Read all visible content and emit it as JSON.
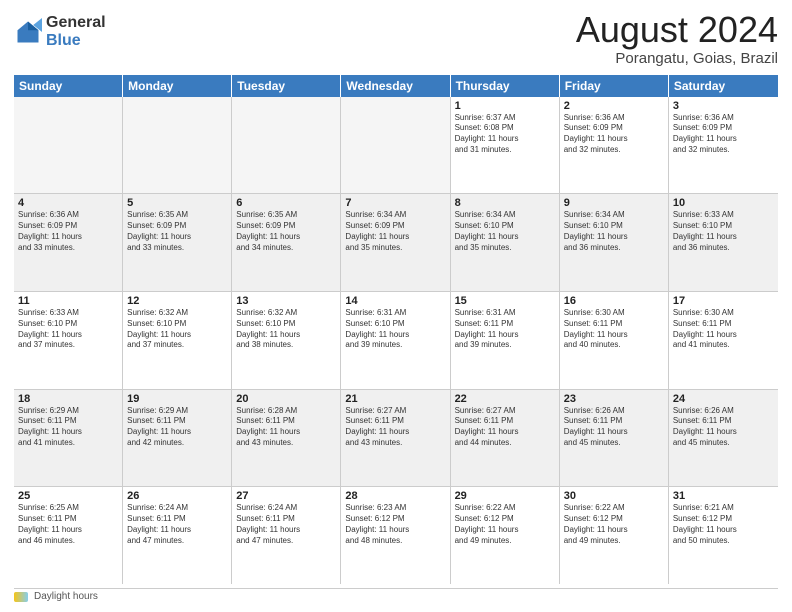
{
  "header": {
    "logo_general": "General",
    "logo_blue": "Blue",
    "month_title": "August 2024",
    "location": "Porangatu, Goias, Brazil"
  },
  "days_of_week": [
    "Sunday",
    "Monday",
    "Tuesday",
    "Wednesday",
    "Thursday",
    "Friday",
    "Saturday"
  ],
  "footer_label": "Daylight hours",
  "weeks": [
    [
      {
        "day": "",
        "info": "",
        "empty": true
      },
      {
        "day": "",
        "info": "",
        "empty": true
      },
      {
        "day": "",
        "info": "",
        "empty": true
      },
      {
        "day": "",
        "info": "",
        "empty": true
      },
      {
        "day": "1",
        "info": "Sunrise: 6:37 AM\nSunset: 6:08 PM\nDaylight: 11 hours\nand 31 minutes.",
        "empty": false
      },
      {
        "day": "2",
        "info": "Sunrise: 6:36 AM\nSunset: 6:09 PM\nDaylight: 11 hours\nand 32 minutes.",
        "empty": false
      },
      {
        "day": "3",
        "info": "Sunrise: 6:36 AM\nSunset: 6:09 PM\nDaylight: 11 hours\nand 32 minutes.",
        "empty": false
      }
    ],
    [
      {
        "day": "4",
        "info": "Sunrise: 6:36 AM\nSunset: 6:09 PM\nDaylight: 11 hours\nand 33 minutes.",
        "empty": false
      },
      {
        "day": "5",
        "info": "Sunrise: 6:35 AM\nSunset: 6:09 PM\nDaylight: 11 hours\nand 33 minutes.",
        "empty": false
      },
      {
        "day": "6",
        "info": "Sunrise: 6:35 AM\nSunset: 6:09 PM\nDaylight: 11 hours\nand 34 minutes.",
        "empty": false
      },
      {
        "day": "7",
        "info": "Sunrise: 6:34 AM\nSunset: 6:09 PM\nDaylight: 11 hours\nand 35 minutes.",
        "empty": false
      },
      {
        "day": "8",
        "info": "Sunrise: 6:34 AM\nSunset: 6:10 PM\nDaylight: 11 hours\nand 35 minutes.",
        "empty": false
      },
      {
        "day": "9",
        "info": "Sunrise: 6:34 AM\nSunset: 6:10 PM\nDaylight: 11 hours\nand 36 minutes.",
        "empty": false
      },
      {
        "day": "10",
        "info": "Sunrise: 6:33 AM\nSunset: 6:10 PM\nDaylight: 11 hours\nand 36 minutes.",
        "empty": false
      }
    ],
    [
      {
        "day": "11",
        "info": "Sunrise: 6:33 AM\nSunset: 6:10 PM\nDaylight: 11 hours\nand 37 minutes.",
        "empty": false
      },
      {
        "day": "12",
        "info": "Sunrise: 6:32 AM\nSunset: 6:10 PM\nDaylight: 11 hours\nand 37 minutes.",
        "empty": false
      },
      {
        "day": "13",
        "info": "Sunrise: 6:32 AM\nSunset: 6:10 PM\nDaylight: 11 hours\nand 38 minutes.",
        "empty": false
      },
      {
        "day": "14",
        "info": "Sunrise: 6:31 AM\nSunset: 6:10 PM\nDaylight: 11 hours\nand 39 minutes.",
        "empty": false
      },
      {
        "day": "15",
        "info": "Sunrise: 6:31 AM\nSunset: 6:11 PM\nDaylight: 11 hours\nand 39 minutes.",
        "empty": false
      },
      {
        "day": "16",
        "info": "Sunrise: 6:30 AM\nSunset: 6:11 PM\nDaylight: 11 hours\nand 40 minutes.",
        "empty": false
      },
      {
        "day": "17",
        "info": "Sunrise: 6:30 AM\nSunset: 6:11 PM\nDaylight: 11 hours\nand 41 minutes.",
        "empty": false
      }
    ],
    [
      {
        "day": "18",
        "info": "Sunrise: 6:29 AM\nSunset: 6:11 PM\nDaylight: 11 hours\nand 41 minutes.",
        "empty": false
      },
      {
        "day": "19",
        "info": "Sunrise: 6:29 AM\nSunset: 6:11 PM\nDaylight: 11 hours\nand 42 minutes.",
        "empty": false
      },
      {
        "day": "20",
        "info": "Sunrise: 6:28 AM\nSunset: 6:11 PM\nDaylight: 11 hours\nand 43 minutes.",
        "empty": false
      },
      {
        "day": "21",
        "info": "Sunrise: 6:27 AM\nSunset: 6:11 PM\nDaylight: 11 hours\nand 43 minutes.",
        "empty": false
      },
      {
        "day": "22",
        "info": "Sunrise: 6:27 AM\nSunset: 6:11 PM\nDaylight: 11 hours\nand 44 minutes.",
        "empty": false
      },
      {
        "day": "23",
        "info": "Sunrise: 6:26 AM\nSunset: 6:11 PM\nDaylight: 11 hours\nand 45 minutes.",
        "empty": false
      },
      {
        "day": "24",
        "info": "Sunrise: 6:26 AM\nSunset: 6:11 PM\nDaylight: 11 hours\nand 45 minutes.",
        "empty": false
      }
    ],
    [
      {
        "day": "25",
        "info": "Sunrise: 6:25 AM\nSunset: 6:11 PM\nDaylight: 11 hours\nand 46 minutes.",
        "empty": false
      },
      {
        "day": "26",
        "info": "Sunrise: 6:24 AM\nSunset: 6:11 PM\nDaylight: 11 hours\nand 47 minutes.",
        "empty": false
      },
      {
        "day": "27",
        "info": "Sunrise: 6:24 AM\nSunset: 6:11 PM\nDaylight: 11 hours\nand 47 minutes.",
        "empty": false
      },
      {
        "day": "28",
        "info": "Sunrise: 6:23 AM\nSunset: 6:12 PM\nDaylight: 11 hours\nand 48 minutes.",
        "empty": false
      },
      {
        "day": "29",
        "info": "Sunrise: 6:22 AM\nSunset: 6:12 PM\nDaylight: 11 hours\nand 49 minutes.",
        "empty": false
      },
      {
        "day": "30",
        "info": "Sunrise: 6:22 AM\nSunset: 6:12 PM\nDaylight: 11 hours\nand 49 minutes.",
        "empty": false
      },
      {
        "day": "31",
        "info": "Sunrise: 6:21 AM\nSunset: 6:12 PM\nDaylight: 11 hours\nand 50 minutes.",
        "empty": false
      }
    ]
  ]
}
